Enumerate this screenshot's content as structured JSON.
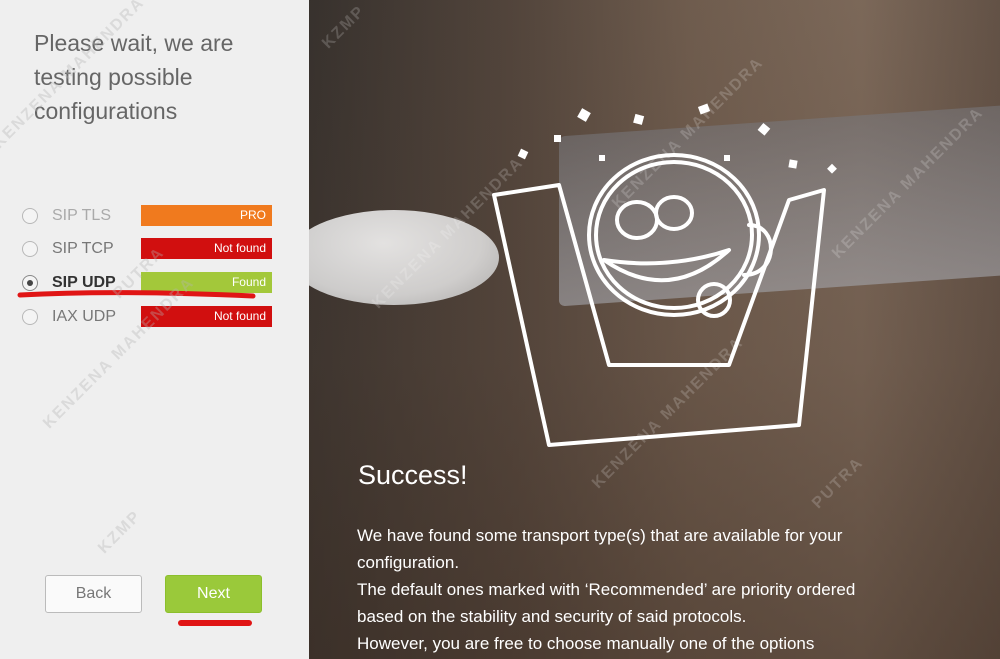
{
  "left_panel": {
    "heading": "Please wait, we are\ntesting possible\nconfigurations",
    "options": [
      {
        "label": "SIP TLS",
        "status": "PRO",
        "status_color": "#f07a1e",
        "selected": false
      },
      {
        "label": "SIP TCP",
        "status": "Not found",
        "status_color": "#d10f0f",
        "selected": false
      },
      {
        "label": "SIP UDP",
        "status": "Found",
        "status_color": "#a3c83a",
        "selected": true
      },
      {
        "label": "IAX UDP",
        "status": "Not found",
        "status_color": "#d10f0f",
        "selected": false
      }
    ],
    "back_label": "Back",
    "next_label": "Next",
    "next_color": "#9ac93a"
  },
  "right_panel": {
    "title": "Success!",
    "body_lines": [
      " We have found some transport type(s) that are available for your configuration.",
      "The default ones marked with ‘Recommended’ are priority ordered based on the stability and security of said protocols.",
      "However, you are free to choose manually one of the options"
    ]
  },
  "watermark": {
    "text": "KENZENA MAHENDRA",
    "subtext": "PUTRA",
    "logo": "KZMP"
  },
  "annotation_color": "#e01515"
}
